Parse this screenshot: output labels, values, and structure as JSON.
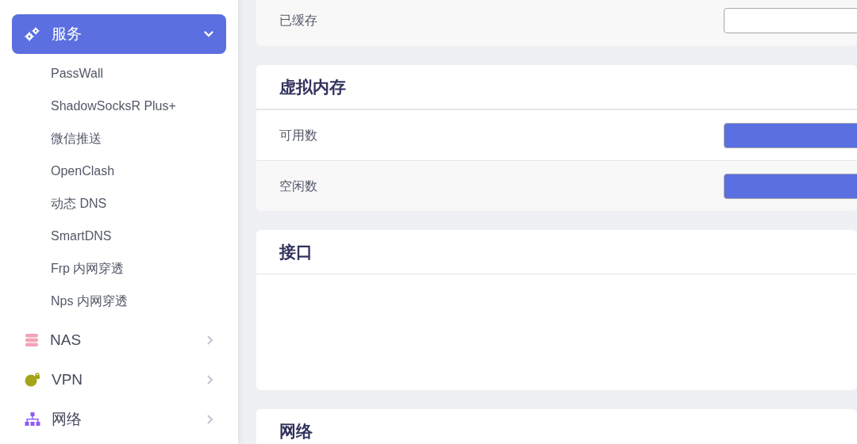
{
  "sidebar": {
    "items": [
      {
        "label": "服务",
        "kind": "services",
        "expanded": true,
        "selected": true,
        "children": [
          {
            "label": "PassWall"
          },
          {
            "label": "ShadowSocksR Plus+"
          },
          {
            "label": "微信推送"
          },
          {
            "label": "OpenClash"
          },
          {
            "label": "动态 DNS"
          },
          {
            "label": "SmartDNS"
          },
          {
            "label": "Frp 内网穿透"
          },
          {
            "label": "Nps 内网穿透"
          }
        ]
      },
      {
        "label": "NAS",
        "kind": "storage",
        "expanded": false,
        "selected": false
      },
      {
        "label": "VPN",
        "kind": "vpn",
        "expanded": false,
        "selected": false
      },
      {
        "label": "网络",
        "kind": "network",
        "expanded": false,
        "selected": false
      }
    ]
  },
  "sections": [
    {
      "rows": [
        {
          "label": "已缓存",
          "filled": false
        }
      ]
    },
    {
      "title": "虚拟内存",
      "rows": [
        {
          "label": "可用数",
          "filled": true
        },
        {
          "label": "空闲数",
          "filled": true
        }
      ]
    },
    {
      "title": "接口"
    },
    {
      "title": "网络"
    }
  ]
}
